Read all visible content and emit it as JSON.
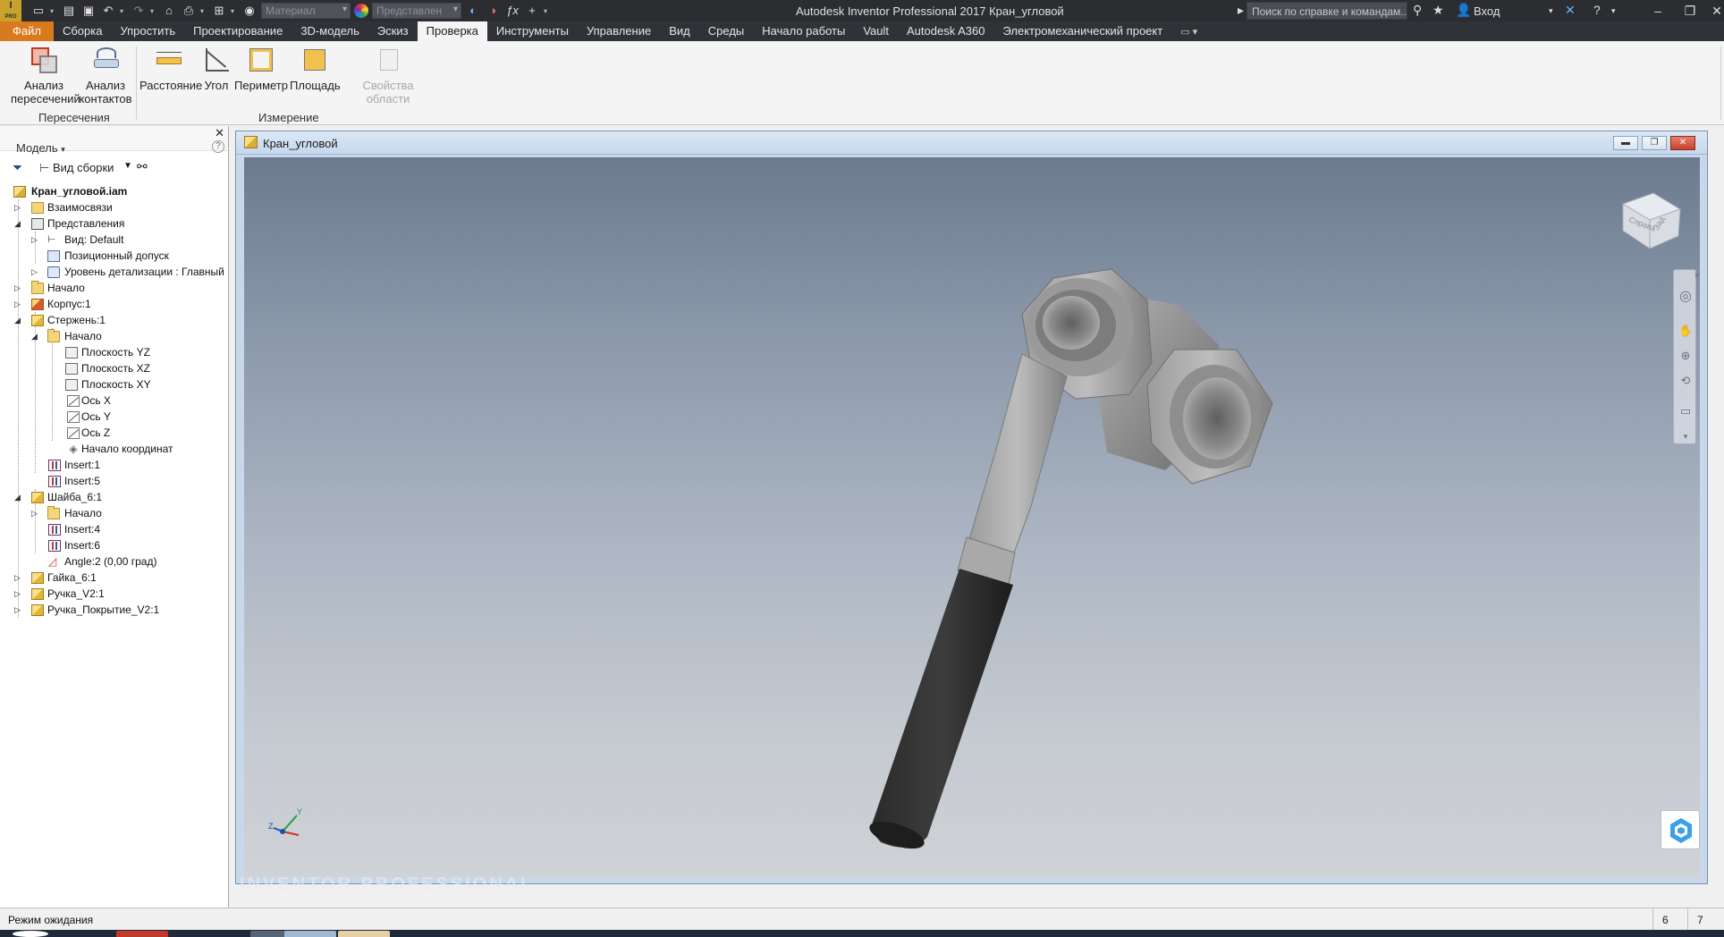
{
  "titlebar": {
    "logo": "I",
    "logo_sub": "PRO",
    "material_combo": "Материал",
    "appearance_combo": "Представлен",
    "app_title": "Autodesk Inventor Professional 2017     Кран_угловой",
    "help_search_placeholder": "Поиск по справке и командам...",
    "sign_in": "Вход"
  },
  "tabs": [
    {
      "label": "Файл"
    },
    {
      "label": "Сборка"
    },
    {
      "label": "Упростить"
    },
    {
      "label": "Проектирование"
    },
    {
      "label": "3D-модель"
    },
    {
      "label": "Эскиз"
    },
    {
      "label": "Проверка"
    },
    {
      "label": "Инструменты"
    },
    {
      "label": "Управление"
    },
    {
      "label": "Вид"
    },
    {
      "label": "Среды"
    },
    {
      "label": "Начало работы"
    },
    {
      "label": "Vault"
    },
    {
      "label": "Autodesk A360"
    },
    {
      "label": "Электромеханический проект"
    }
  ],
  "ribbon": {
    "interference": {
      "line1": "Анализ",
      "line2": "пересечений"
    },
    "contacts": {
      "line1": "Анализ",
      "line2": "контактов"
    },
    "group_intersections": "Пересечения",
    "distance": "Расстояние",
    "angle": "Угол",
    "perimeter": "Периметр",
    "area": "Площадь",
    "region_props": "Свойства области",
    "group_measure": "Измерение"
  },
  "browser": {
    "title": "Модель",
    "view_label": "Вид сборки",
    "rows": [
      {
        "label": "Кран_угловой.iam"
      },
      {
        "label": "Взаимосвязи"
      },
      {
        "label": "Представления"
      },
      {
        "label": "Вид: Default"
      },
      {
        "label": "Позиционный допуск"
      },
      {
        "label": "Уровень детализации : Главный"
      },
      {
        "label": "Начало"
      },
      {
        "label": "Корпус:1"
      },
      {
        "label": "Стержень:1"
      },
      {
        "label": "Начало"
      },
      {
        "label": "Плоскость YZ"
      },
      {
        "label": "Плоскость XZ"
      },
      {
        "label": "Плоскость XY"
      },
      {
        "label": "Ось X"
      },
      {
        "label": "Ось Y"
      },
      {
        "label": "Ось Z"
      },
      {
        "label": "Начало координат"
      },
      {
        "label": "Insert:1"
      },
      {
        "label": "Insert:5"
      },
      {
        "label": "Шайба_6:1"
      },
      {
        "label": "Начало"
      },
      {
        "label": "Insert:4"
      },
      {
        "label": "Insert:6"
      },
      {
        "label": "Angle:2 (0,00 град)"
      },
      {
        "label": "Гайка_6:1"
      },
      {
        "label": "Ручка_V2:1"
      },
      {
        "label": "Ручка_Покрытие_V2:1"
      }
    ]
  },
  "document": {
    "title": "Кран_угловой",
    "viewcube_face1": "Справа",
    "viewcube_face2": "Зад",
    "watermark": "INVENTOR PROFESSIONAL"
  },
  "status": {
    "text": "Режим ожидания",
    "cell1": "6",
    "cell2": "7"
  },
  "colors": {
    "file_tab": "#d97a1e",
    "titlebar": "#2b2d30",
    "viewport_top": "#6b7a8f",
    "viewport_bottom": "#cfd2d6"
  }
}
